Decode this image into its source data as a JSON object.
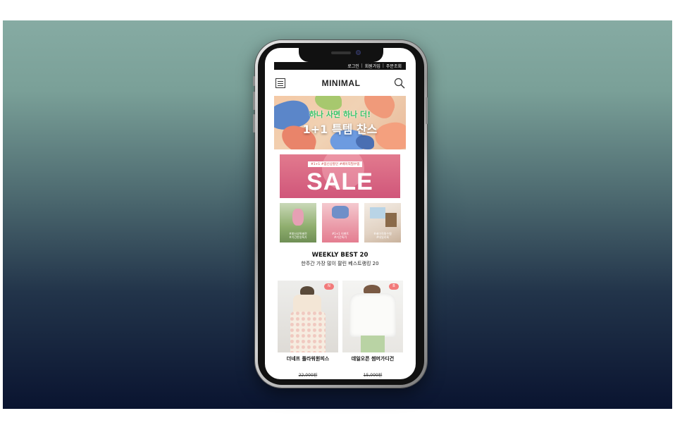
{
  "topbar": {
    "login": "로그인",
    "signup": "회원가입",
    "order": "주문조회",
    "sep": "|"
  },
  "header": {
    "logo": "MINIMAL"
  },
  "banner1": {
    "line1": "하나 사면 하나 더!",
    "line2": "1+1 특템 찬스"
  },
  "banner2": {
    "tags": "#1+1  #봄신상할인  #베이직필수템",
    "title": "SALE"
  },
  "thumbs": [
    {
      "caption1": "#봄신상특별전",
      "caption2": "#기간한정특가"
    },
    {
      "caption1": "#1+1 이벤트",
      "caption2": "#기간특가"
    },
    {
      "caption1": "#베이직필수템",
      "caption2": "#데일리룩"
    }
  ],
  "weekly": {
    "title": "WEEKLY BEST 20",
    "subtitle": "한주간 가장 많이 팔린 베스트랭킹 20"
  },
  "products": [
    {
      "badge": "N",
      "name": "더네프 플라워원피스",
      "price": "22,000원"
    },
    {
      "badge": "B",
      "name": "데일오픈 썸머가디건",
      "price": "15,000원"
    }
  ],
  "colors": {
    "accent": "#f27a7a",
    "sale_bg": "#d85f82",
    "topbar_bg": "#111111"
  }
}
